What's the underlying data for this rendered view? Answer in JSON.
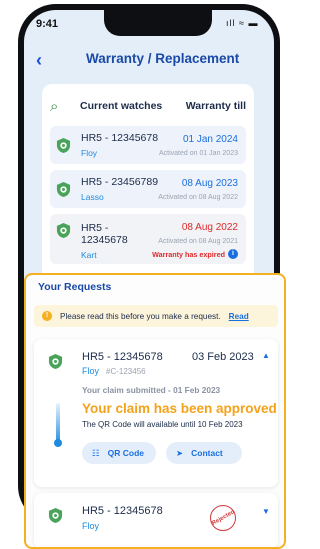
{
  "status_bar": {
    "time": "9:41",
    "icons": "ıll ≈ ▬"
  },
  "header": {
    "title": "Warranty / Replacement"
  },
  "watches": {
    "col_watch": "Current watches",
    "col_warranty": "Warranty till",
    "items": [
      {
        "serial": "HR5 - 12345678",
        "name": "Floy",
        "warranty_till": "01 Jan 2024",
        "activated": "Activated on 01 Jan 2023",
        "expired": ""
      },
      {
        "serial": "HR5 - 23456789",
        "name": "Lasso",
        "warranty_till": "08 Aug 2023",
        "activated": "Activated on 08 Aug 2022",
        "expired": ""
      },
      {
        "serial": "HR5 - 12345678",
        "name": "Kart",
        "warranty_till": "08 Aug 2022",
        "activated": "Activated on 08 Aug 2021",
        "expired": "Warranty has expired"
      }
    ]
  },
  "requests": {
    "title": "Your Requests",
    "notice": "Please read this before you make a request.",
    "notice_link": "Read",
    "card1": {
      "serial": "HR5 - 12345678",
      "date": "03 Feb 2023",
      "name": "Floy",
      "case_id": "#C-123456",
      "submitted": "Your claim submitted - 01 Feb 2023",
      "status": "Your claim has been approved",
      "qr_note": "The QR Code will available until 10 Feb 2023",
      "qr_button": "QR Code",
      "contact_button": "Contact"
    },
    "card2": {
      "serial": "HR5 - 12345678",
      "name": "Floy",
      "stamp": "Rejected"
    }
  },
  "colors": {
    "accent": "#1a6fe0",
    "approved": "#f4a21a",
    "expired": "#e02a2a",
    "panel_border": "#f4b020"
  }
}
